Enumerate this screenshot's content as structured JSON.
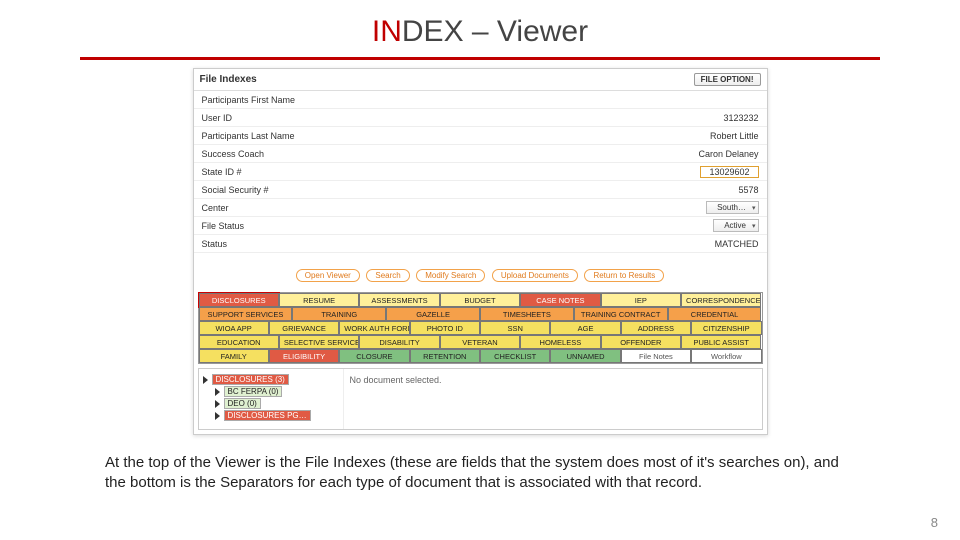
{
  "title": {
    "part1": "IN",
    "part2": "DEX",
    "part3": " – Viewer"
  },
  "panel_title": "File Indexes",
  "file_option_btn": "FILE OPTION!",
  "fields": {
    "first_name": {
      "label": "Participants First Name",
      "value": ""
    },
    "user_id": {
      "label": "User ID",
      "value": "3123232"
    },
    "last_name": {
      "label": "Participants Last Name",
      "value": "Robert Little"
    },
    "coach": {
      "label": "Success Coach",
      "value": "Caron Delaney"
    },
    "state_id": {
      "label": "State ID #",
      "value": "13029602"
    },
    "ssn": {
      "label": "Social Security #",
      "value": "5578"
    },
    "center": {
      "label": "Center",
      "value": "South…"
    },
    "file_status": {
      "label": "File Status",
      "value": "Active"
    },
    "status": {
      "label": "Status",
      "value": "MATCHED"
    }
  },
  "actions": {
    "open_viewer": "Open Viewer",
    "search": "Search",
    "modify_search": "Modify Search",
    "upload_docs": "Upload Documents",
    "return_results": "Return to Results"
  },
  "tabs": {
    "r1": [
      "DISCLOSURES",
      "RESUME",
      "ASSESSMENTS",
      "BUDGET",
      "CASE NOTES",
      "IEP",
      "CORRESPONDENCE"
    ],
    "r2": [
      "SUPPORT SERVICES",
      "TRAINING",
      "GAZELLE",
      "TIMESHEETS",
      "TRAINING CONTRACT",
      "CREDENTIAL"
    ],
    "r3": [
      "WIOA APP",
      "GRIEVANCE",
      "WORK AUTH FORM",
      "PHOTO ID",
      "SSN",
      "AGE",
      "ADDRESS",
      "CITIZENSHIP"
    ],
    "r4": [
      "EDUCATION",
      "SELECTIVE SERVICE",
      "DISABILITY",
      "VETERAN",
      "HOMELESS",
      "OFFENDER",
      "PUBLIC ASSIST"
    ],
    "r5": [
      "FAMILY",
      "ELIGIBILITY",
      "CLOSURE",
      "RETENTION",
      "CHECKLIST",
      "UNNAMED",
      "File Notes",
      "Workflow"
    ]
  },
  "tree": {
    "n1": "DISCLOSURES (3)",
    "n2": "BC FERPA (0)",
    "n3": "DEO (0)",
    "n4": "DISCLOSURES PG…",
    "empty": "No document selected."
  },
  "caption": "At the top of the Viewer is the File Indexes (these are fields that the system does most of it's searches on), and the bottom is the Separators for each type of document that is associated with that record.",
  "page_number": "8"
}
